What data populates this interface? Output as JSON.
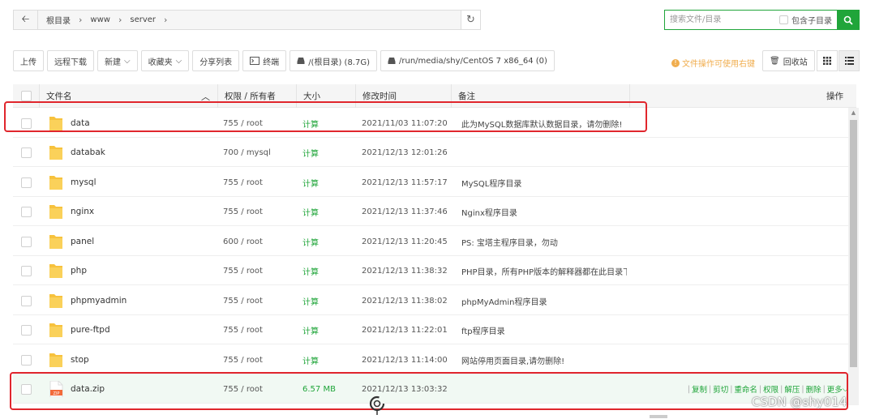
{
  "pathbar": {
    "back_icon": "arrow-left-icon",
    "crumbs": [
      "根目录",
      "www",
      "server"
    ],
    "refresh_icon": "refresh-icon"
  },
  "search": {
    "placeholder": "搜索文件/目录",
    "subdir_label": "包含子目录",
    "button_icon": "search-icon"
  },
  "toolbar": {
    "upload": "上传",
    "remote_download": "远程下载",
    "new": "新建",
    "favorites": "收藏夹",
    "share_list": "分享列表",
    "terminal": "终端",
    "disk1": "/(根目录) (8.7G)",
    "disk2": "/run/media/shy/CentOS 7 x86_64 (0)",
    "tip": "文件操作可使用右键",
    "recycle": "回收站"
  },
  "table": {
    "headers": {
      "name": "文件名",
      "perm": "权限 / 所有者",
      "size": "大小",
      "mtime": "修改时间",
      "note": "备注",
      "ops": "操作"
    },
    "rows": [
      {
        "name": "data",
        "perm": "755 / root",
        "size": "计算",
        "mtime": "2021/11/03 11:07:20",
        "note": "此为MySQL数据库默认数据目录，请勿删除!",
        "type": "folder"
      },
      {
        "name": "databak",
        "perm": "700 / mysql",
        "size": "计算",
        "mtime": "2021/12/13 12:01:26",
        "note": "",
        "type": "folder"
      },
      {
        "name": "mysql",
        "perm": "755 / root",
        "size": "计算",
        "mtime": "2021/12/13 11:57:17",
        "note": "MySQL程序目录",
        "type": "folder"
      },
      {
        "name": "nginx",
        "perm": "755 / root",
        "size": "计算",
        "mtime": "2021/12/13 11:37:46",
        "note": "Nginx程序目录",
        "type": "folder"
      },
      {
        "name": "panel",
        "perm": "600 / root",
        "size": "计算",
        "mtime": "2021/12/13 11:20:45",
        "note": "PS: 宝塔主程序目录，勿动",
        "type": "folder"
      },
      {
        "name": "php",
        "perm": "755 / root",
        "size": "计算",
        "mtime": "2021/12/13 11:38:32",
        "note": "PHP目录，所有PHP版本的解释器都在此目录下",
        "type": "folder"
      },
      {
        "name": "phpmyadmin",
        "perm": "755 / root",
        "size": "计算",
        "mtime": "2021/12/13 11:38:02",
        "note": "phpMyAdmin程序目录",
        "type": "folder"
      },
      {
        "name": "pure-ftpd",
        "perm": "755 / root",
        "size": "计算",
        "mtime": "2021/12/13 11:22:01",
        "note": "ftp程序目录",
        "type": "folder"
      },
      {
        "name": "stop",
        "perm": "755 / root",
        "size": "计算",
        "mtime": "2021/12/13 11:14:00",
        "note": "网站停用页面目录,请勿删除!",
        "type": "folder"
      },
      {
        "name": "data.zip",
        "perm": "755 / root",
        "size": "6.57 MB",
        "mtime": "2021/12/13 13:03:32",
        "note": "",
        "type": "zip",
        "ops": [
          "复制",
          "剪切",
          "重命名",
          "权限",
          "解压",
          "删除",
          "更多"
        ]
      }
    ]
  },
  "watermark": "CSDN @shy014",
  "colors": {
    "accent": "#20a53a",
    "highlight_border": "#e0262d",
    "tip": "#f0ad4e"
  }
}
